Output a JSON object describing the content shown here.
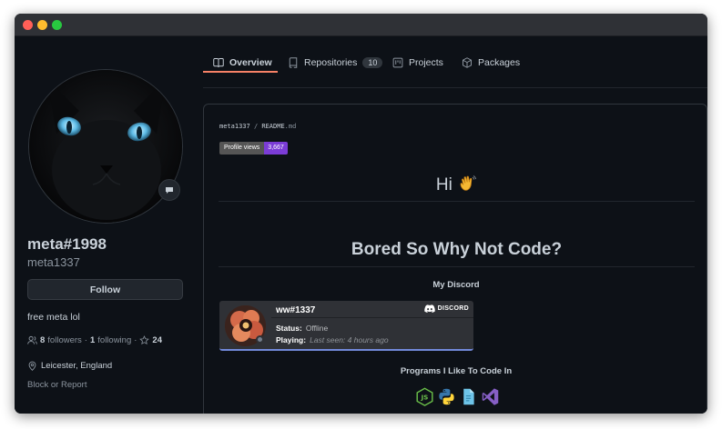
{
  "tabs": [
    {
      "label": "Overview",
      "icon": "book-icon",
      "active": true
    },
    {
      "label": "Repositories",
      "icon": "repo-icon",
      "count": "10"
    },
    {
      "label": "Projects",
      "icon": "project-icon"
    },
    {
      "label": "Packages",
      "icon": "package-icon"
    }
  ],
  "profile": {
    "display_name": "meta#1998",
    "username": "meta1337",
    "follow_label": "Follow",
    "bio": "free meta lol",
    "followers_count": "8",
    "followers_label": "followers",
    "following_count": "1",
    "following_label": "following",
    "stars_count": "24",
    "location": "Leicester, England",
    "block_report": "Block or Report"
  },
  "readme": {
    "owner": "meta1337",
    "separator": "/",
    "file": "README",
    "ext": ".md",
    "badge_label": "Profile views",
    "badge_value": "3,667",
    "hi": "Hi",
    "heading": "Bored So Why Not Code?",
    "discord_heading": "My Discord",
    "programs_heading": "Programs I Like To Code In"
  },
  "discord": {
    "user": "ww#1337",
    "brand": "DISCORD",
    "status_label": "Status:",
    "status_value": "Offline",
    "playing_label": "Playing:",
    "playing_value": "Last seen: 4 hours ago"
  },
  "languages": [
    "nodejs-icon",
    "python-icon",
    "file-icon",
    "visual-studio-icon"
  ],
  "colors": {
    "background": "#0d1117",
    "accent_underline": "#f78166",
    "badge_value": "#7b3cd6",
    "discord_card": "#2f3136",
    "discord_accent": "#7289da"
  }
}
